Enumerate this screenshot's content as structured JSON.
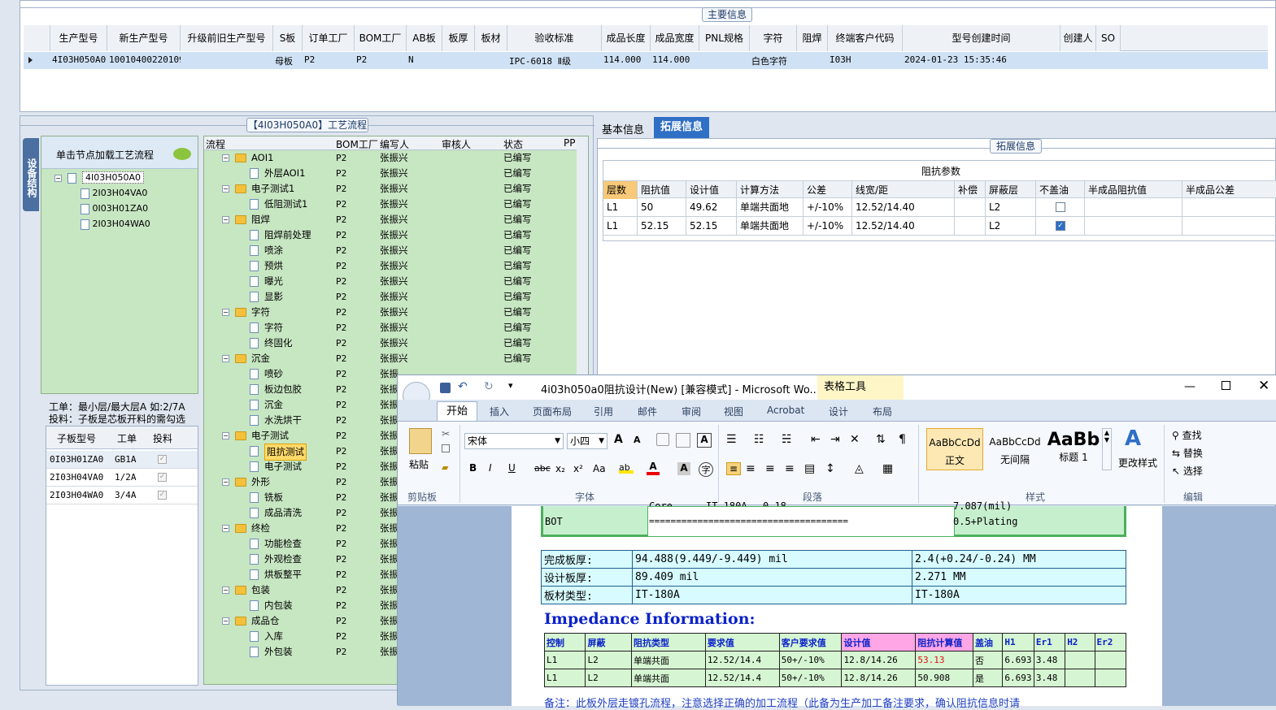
{
  "main_info": {
    "section_title": "主要信息",
    "columns": [
      "生产型号",
      "新生产型号",
      "升级前旧生产型号",
      "S板",
      "订单工厂",
      "BOM工厂",
      "AB板",
      "板厚",
      "板材",
      "验收标准",
      "成品长度",
      "成品宽度",
      "PNL规格",
      "字符",
      "阻焊",
      "终端客户代码",
      "型号创建时间",
      "创建人",
      "SO"
    ],
    "row": [
      "4I03H050A0",
      "10010400220109",
      "",
      "母板",
      "P2",
      "P2",
      "N",
      "",
      "",
      "IPC-6018 Ⅱ级",
      "114.000",
      "114.000",
      "",
      "白色字符",
      "",
      "I03H",
      "2024-01-23 15:35:46",
      "",
      ""
    ]
  },
  "process": {
    "title": "【4I03H050A0】工艺流程",
    "columns": [
      "流程",
      "BOM工厂",
      "编写人",
      "审核人",
      "状态",
      "PP"
    ],
    "rows": [
      {
        "name": "AOI1",
        "type": "folder",
        "factory": "P2",
        "author": "张振兴",
        "status": "已编写"
      },
      {
        "name": "外层AOI1",
        "type": "doc",
        "factory": "P2",
        "author": "张振兴",
        "status": "已编写"
      },
      {
        "name": "电子测试1",
        "type": "folder",
        "factory": "P2",
        "author": "张振兴",
        "status": "已编写"
      },
      {
        "name": "低阻测试1",
        "type": "doc",
        "factory": "P2",
        "author": "张振兴",
        "status": "已编写"
      },
      {
        "name": "阻焊",
        "type": "folder",
        "factory": "P2",
        "author": "张振兴",
        "status": "已编写"
      },
      {
        "name": "阻焊前处理",
        "type": "doc",
        "factory": "P2",
        "author": "张振兴",
        "status": "已编写"
      },
      {
        "name": "喷涂",
        "type": "doc",
        "factory": "P2",
        "author": "张振兴",
        "status": "已编写"
      },
      {
        "name": "预烘",
        "type": "doc",
        "factory": "P2",
        "author": "张振兴",
        "status": "已编写"
      },
      {
        "name": "曝光",
        "type": "doc",
        "factory": "P2",
        "author": "张振兴",
        "status": "已编写"
      },
      {
        "name": "显影",
        "type": "doc",
        "factory": "P2",
        "author": "张振兴",
        "status": "已编写"
      },
      {
        "name": "字符",
        "type": "folder",
        "factory": "P2",
        "author": "张振兴",
        "status": "已编写"
      },
      {
        "name": "字符",
        "type": "doc",
        "factory": "P2",
        "author": "张振兴",
        "status": "已编写"
      },
      {
        "name": "终固化",
        "type": "doc",
        "factory": "P2",
        "author": "张振兴",
        "status": "已编写"
      },
      {
        "name": "沉金",
        "type": "folder",
        "factory": "P2",
        "author": "张振兴",
        "status": "已编写"
      },
      {
        "name": "喷砂",
        "type": "doc",
        "factory": "P2",
        "author": "张振",
        "status": ""
      },
      {
        "name": "板边包胶",
        "type": "doc",
        "factory": "P2",
        "author": "张振",
        "status": ""
      },
      {
        "name": "沉金",
        "type": "doc",
        "factory": "P2",
        "author": "张振",
        "status": ""
      },
      {
        "name": "水洗烘干",
        "type": "doc",
        "factory": "P2",
        "author": "张振",
        "status": ""
      },
      {
        "name": "电子测试",
        "type": "folder",
        "factory": "P2",
        "author": "张振",
        "status": ""
      },
      {
        "name": "阻抗测试",
        "type": "doc",
        "factory": "P2",
        "author": "张振",
        "status": "",
        "selected": true
      },
      {
        "name": "电子测试",
        "type": "doc",
        "factory": "P2",
        "author": "张振",
        "status": ""
      },
      {
        "name": "外形",
        "type": "folder",
        "factory": "P2",
        "author": "张振",
        "status": ""
      },
      {
        "name": "铣板",
        "type": "doc",
        "factory": "P2",
        "author": "张振",
        "status": ""
      },
      {
        "name": "成品清洗",
        "type": "doc",
        "factory": "P2",
        "author": "张振",
        "status": ""
      },
      {
        "name": "终检",
        "type": "folder",
        "factory": "P2",
        "author": "张振",
        "status": ""
      },
      {
        "name": "功能检查",
        "type": "doc",
        "factory": "P2",
        "author": "张振",
        "status": ""
      },
      {
        "name": "外观检查",
        "type": "doc",
        "factory": "P2",
        "author": "张振",
        "status": ""
      },
      {
        "name": "烘板整平",
        "type": "doc",
        "factory": "P2",
        "author": "张振",
        "status": ""
      },
      {
        "name": "包装",
        "type": "folder",
        "factory": "P2",
        "author": "张振",
        "status": ""
      },
      {
        "name": "内包装",
        "type": "doc",
        "factory": "P2",
        "author": "张振",
        "status": ""
      },
      {
        "name": "成品仓",
        "type": "folder",
        "factory": "P2",
        "author": "张振",
        "status": ""
      },
      {
        "name": "入库",
        "type": "doc",
        "factory": "P2",
        "author": "张振",
        "status": ""
      },
      {
        "name": "外包装",
        "type": "doc",
        "factory": "P2",
        "author": "张振",
        "status": ""
      }
    ]
  },
  "device_tab": "设备结构",
  "tree_panel": {
    "hint": "单击节点加载工艺流程",
    "root": "4I03H050A0",
    "children": [
      "2I03H04VA0",
      "0I03H01ZA0",
      "2I03H04WA0"
    ],
    "info_line1": "工单：最小层/最大层A 如:2/7A",
    "info_line2": "投料：子板是芯板开料的需勾选"
  },
  "sub_boards": {
    "columns": [
      "子板型号",
      "工单",
      "投料"
    ],
    "rows": [
      [
        "0I03H01ZA0",
        "GB1A"
      ],
      [
        "2I03H04VA0",
        "1/2A"
      ],
      [
        "2I03H04WA0",
        "3/4A"
      ]
    ]
  },
  "right_tabs": {
    "tab1": "基本信息",
    "tab2": "拓展信息"
  },
  "extend": {
    "title": "拓展信息",
    "impedance_title": "阻抗参数",
    "columns": [
      "层数",
      "阻抗值",
      "设计值",
      "计算方法",
      "公差",
      "线宽/距",
      "补偿",
      "屏蔽层",
      "不盖油",
      "半成品阻抗值",
      "半成品公差"
    ],
    "rows": [
      [
        "L1",
        "50",
        "49.62",
        "单端共面地",
        "+/-10%",
        "12.52/14.40",
        "",
        "L2"
      ],
      [
        "L1",
        "52.15",
        "52.15",
        "单端共面地",
        "+/-10%",
        "12.52/14.40",
        "",
        "L2"
      ]
    ],
    "checked": [
      false,
      true
    ]
  },
  "word": {
    "title": "4i03h050a0阻抗设计(New) [兼容模式] - Microsoft Wo...",
    "context_tab": "表格工具",
    "tabs": [
      "开始",
      "插入",
      "页面布局",
      "引用",
      "邮件",
      "审阅",
      "视图",
      "Acrobat",
      "设计",
      "布局"
    ],
    "font_name": "宋体",
    "font_size": "小四",
    "clipboard_label": "剪贴板",
    "paste_label": "粘贴",
    "font_group": "字体",
    "para_group": "段落",
    "styles_group": "样式",
    "edit_group": "编辑",
    "styles": [
      {
        "sample": "AaBbCcDd",
        "name": "正文"
      },
      {
        "sample": "AaBbCcDd",
        "name": "无间隔"
      },
      {
        "sample": "AaBb",
        "name": "标题 1"
      }
    ],
    "change_style": "更改样式",
    "find": "查找",
    "replace": "替换",
    "select": "选择",
    "doc": {
      "top_partial_left": "Core",
      "top_partial_mid": "IT-180A",
      "top_partial_val": "0.18",
      "top_partial_right": "7.087(mil)",
      "bot_label": "BOT",
      "bot_line": "=====================================",
      "bot_val": "0.5+Plating",
      "thickness_rows": [
        [
          "完成板厚:",
          "94.488(9.449/-9.449) mil",
          "2.4(+0.24/-0.24) MM"
        ],
        [
          "设计板厚:",
          "89.409 mil",
          "2.271 MM"
        ],
        [
          "板材类型:",
          "IT-180A",
          "IT-180A"
        ]
      ],
      "impedance_heading": "Impedance Information:",
      "imp_columns": [
        "控制",
        "屏蔽",
        "阻抗类型",
        "要求值",
        "客户要求值",
        "设计值",
        "阻抗计算值",
        "盖油",
        "H1",
        "Er1",
        "H2",
        "Er2"
      ],
      "imp_rows": [
        [
          "L1",
          "L2",
          "单端共面",
          "12.52/14.4",
          "50+/-10%",
          "12.8/14.26",
          "53.13",
          "否",
          "6.693",
          "3.48",
          "",
          ""
        ],
        [
          "L1",
          "L2",
          "单端共面",
          "12.52/14.4",
          "50+/-10%",
          "12.8/14.26",
          "50.908",
          "是",
          "6.693",
          "3.48",
          "",
          ""
        ]
      ],
      "note": "备注：此板外层走镀孔流程，注意选择正确的加工流程（此备为生产加工备注要求，确认阻抗信息时请"
    }
  }
}
